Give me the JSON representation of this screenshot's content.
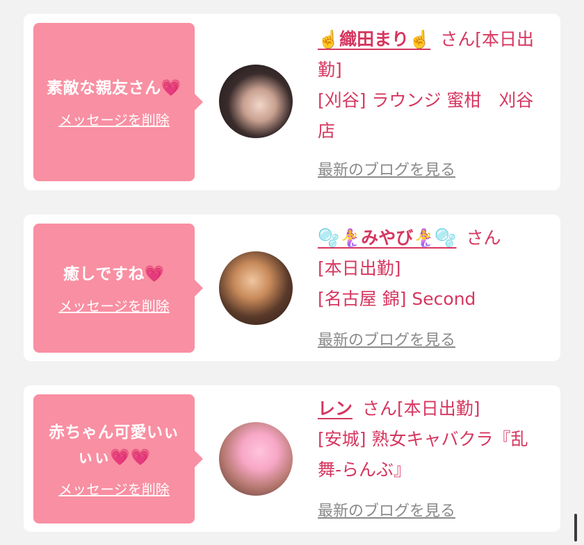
{
  "cards": [
    {
      "message": "素敵な親友さん💗",
      "delete_label": "メッセージを削除",
      "name": "☝️織田まり☝️",
      "honorific": "さん",
      "status": "[本日出勤]",
      "store": "[刈谷] ラウンジ 蜜柑　刈谷店",
      "blog_label": "最新のブログを見る"
    },
    {
      "message": "癒しですね💗",
      "delete_label": "メッセージを削除",
      "name": "🫧🧜‍♀️みやび🧜‍♀️🫧",
      "honorific": "さん",
      "status": "[本日出勤]",
      "store": "[名古屋 錦] Second",
      "blog_label": "最新のブログを見る"
    },
    {
      "message": "赤ちゃん可愛いぃぃぃ💗💗",
      "delete_label": "メッセージを削除",
      "name": "レン",
      "honorific": "さん",
      "status": "[本日出勤]",
      "store": "[安城] 熟女キャバクラ『乱舞-らんぶ』",
      "blog_label": "最新のブログを見る"
    }
  ],
  "colors": {
    "bubble": "#f98fa2",
    "accent": "#d6365f",
    "muted": "#8a8a8a",
    "background": "#f2f2f2"
  }
}
